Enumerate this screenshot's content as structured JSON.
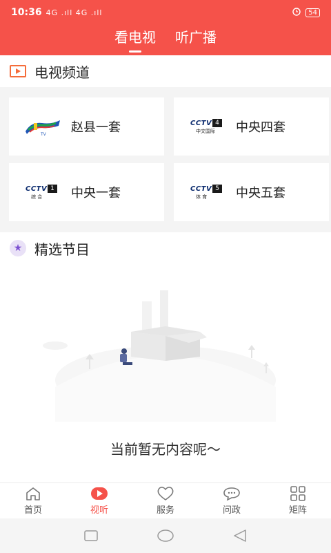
{
  "status_bar": {
    "time": "10:36",
    "signal": "4G .ıll 4G .ıll",
    "battery": "54",
    "alarm_icon": "alarm-icon"
  },
  "tabs": [
    {
      "label": "看电视",
      "active": true
    },
    {
      "label": "听广播",
      "active": false
    }
  ],
  "tv_section": {
    "title": "电视频道",
    "icon": "tv-play-icon"
  },
  "channels": [
    {
      "name": "赵县一套",
      "logo": "zhaoxian-tv-logo"
    },
    {
      "name": "中央四套",
      "logo": "cctv4-logo",
      "logo_num": "4",
      "logo_sub": "中文国际"
    },
    {
      "name": "中央一套",
      "logo": "cctv1-logo",
      "logo_num": "1",
      "logo_sub": "综 合"
    },
    {
      "name": "中央五套",
      "logo": "cctv5-logo",
      "logo_num": "5",
      "logo_sub": "体 育"
    }
  ],
  "cctv_word": "CCTV",
  "featured_section": {
    "title": "精选节目",
    "icon": "star-icon"
  },
  "empty_state": {
    "text": "当前暂无内容呢～",
    "illustration": "empty-box-illustration"
  },
  "bottom_nav": [
    {
      "label": "首页",
      "icon": "home-icon",
      "active": false
    },
    {
      "label": "视听",
      "icon": "play-circle-icon",
      "active": true
    },
    {
      "label": "服务",
      "icon": "heart-icon",
      "active": false
    },
    {
      "label": "问政",
      "icon": "chat-icon",
      "active": false
    },
    {
      "label": "矩阵",
      "icon": "grid-icon",
      "active": false
    }
  ],
  "colors": {
    "accent": "#f5524a",
    "tv_icon": "#f56c3a",
    "star_icon": "#7b4fd1"
  }
}
